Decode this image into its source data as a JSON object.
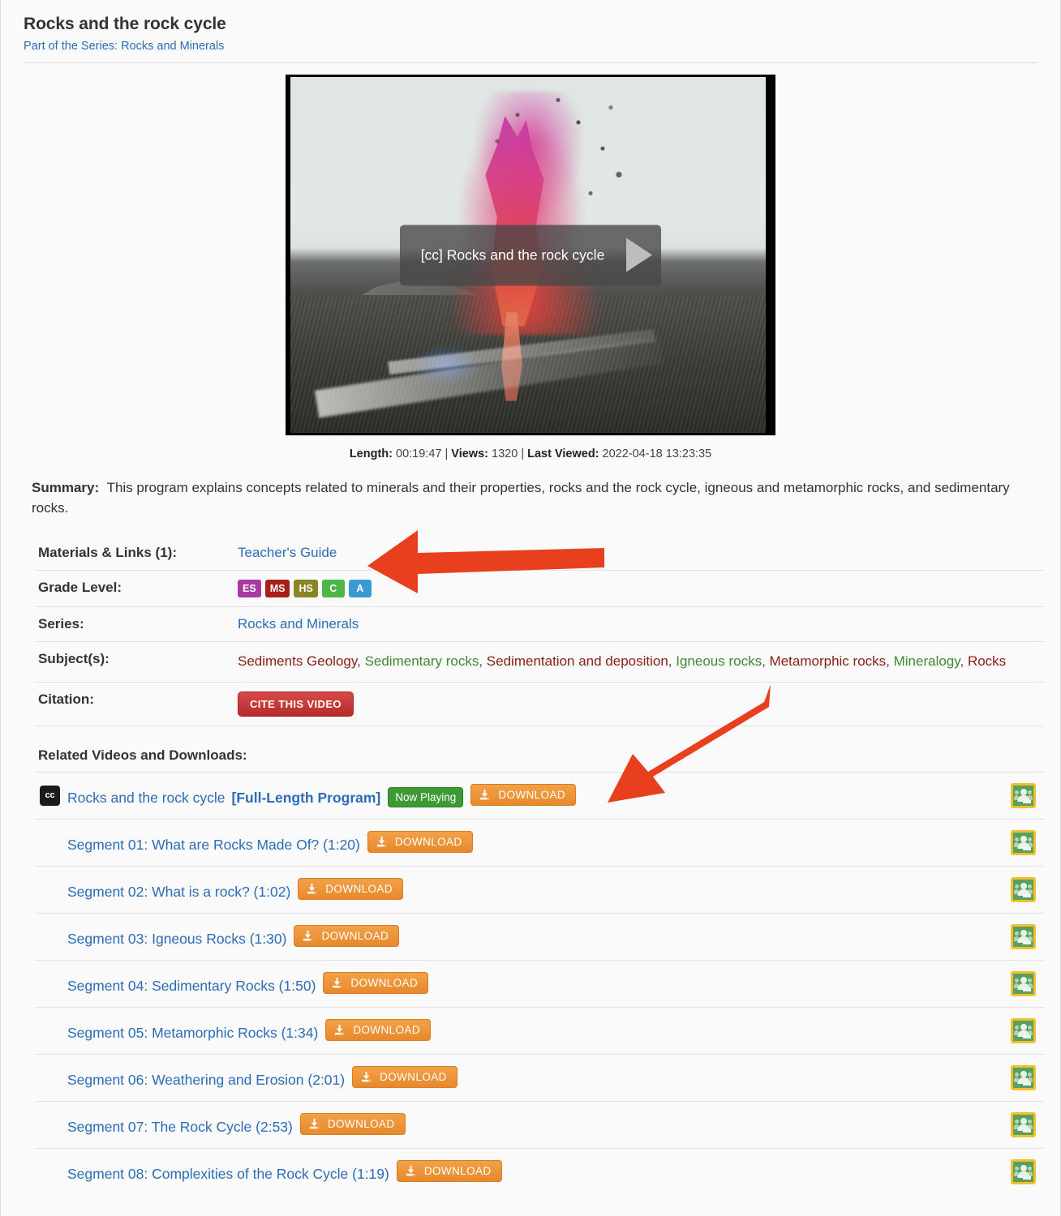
{
  "header": {
    "title": "Rocks and the rock cycle",
    "series_prefix": "Part of the Series:",
    "series_name": "Rocks and Minerals"
  },
  "player": {
    "overlay_title": "[cc] Rocks and the rock cycle",
    "play_icon": "play-triangle-icon"
  },
  "stats": {
    "length_label": "Length:",
    "length_value": "00:19:47",
    "sep1": "|",
    "views_label": "Views:",
    "views_value": "1320",
    "sep2": "|",
    "last_viewed_label": "Last Viewed:",
    "last_viewed_value": "2022-04-18 13:23:35"
  },
  "summary": {
    "label": "Summary:",
    "text": "This program explains concepts related to minerals and their properties, rocks and the rock cycle, igneous and metamorphic rocks, and sedimentary rocks."
  },
  "info": {
    "materials_label": "Materials & Links (1):",
    "materials_link": "Teacher's Guide",
    "grade_label": "Grade Level:",
    "grade_badges": [
      {
        "text": "ES",
        "color": "#a93aa5"
      },
      {
        "text": "MS",
        "color": "#a51f1b"
      },
      {
        "text": "HS",
        "color": "#8a8522"
      },
      {
        "text": "C",
        "color": "#4cb648"
      },
      {
        "text": "A",
        "color": "#3a9bd4"
      }
    ],
    "series_label": "Series:",
    "series_link": "Rocks and Minerals",
    "subjects_label": "Subject(s):",
    "subjects": [
      {
        "text": "Sediments Geology",
        "color": "#8b2017"
      },
      {
        "text": "Sedimentary rocks",
        "color": "#3f8a33"
      },
      {
        "text": "Sedimentation and deposition",
        "color": "#8b2017"
      },
      {
        "text": "Igneous rocks",
        "color": "#3f8a33"
      },
      {
        "text": "Metamorphic rocks",
        "color": "#8b2017"
      },
      {
        "text": "Mineralogy",
        "color": "#3f8a33"
      },
      {
        "text": "Rocks",
        "color": "#8b2017"
      }
    ],
    "citation_label": "Citation:",
    "citation_button": "CITE THIS VIDEO"
  },
  "related": {
    "heading": "Related Videos and Downloads:",
    "download_label": "DOWNLOAD",
    "now_playing_label": "Now Playing",
    "cc_label": "cc",
    "classroom_icon": "google-classroom-icon",
    "rows": [
      {
        "cc": true,
        "title": "Rocks and the rock cycle",
        "tag": "[Full-Length Program]",
        "now_playing": true,
        "indent": false
      },
      {
        "cc": false,
        "title": "Segment 01: What are Rocks Made Of? (1:20)",
        "tag": "",
        "now_playing": false,
        "indent": true
      },
      {
        "cc": false,
        "title": "Segment 02: What is a rock? (1:02)",
        "tag": "",
        "now_playing": false,
        "indent": true
      },
      {
        "cc": false,
        "title": "Segment 03: Igneous Rocks (1:30)",
        "tag": "",
        "now_playing": false,
        "indent": true
      },
      {
        "cc": false,
        "title": "Segment 04: Sedimentary Rocks (1:50)",
        "tag": "",
        "now_playing": false,
        "indent": true
      },
      {
        "cc": false,
        "title": "Segment 05: Metamorphic Rocks (1:34)",
        "tag": "",
        "now_playing": false,
        "indent": true
      },
      {
        "cc": false,
        "title": "Segment 06: Weathering and Erosion (2:01)",
        "tag": "",
        "now_playing": false,
        "indent": true
      },
      {
        "cc": false,
        "title": "Segment 07: The Rock Cycle (2:53)",
        "tag": "",
        "now_playing": false,
        "indent": true
      },
      {
        "cc": false,
        "title": "Segment 08: Complexities of the Rock Cycle (1:19)",
        "tag": "",
        "now_playing": false,
        "indent": true
      }
    ]
  },
  "annotations": {
    "arrow_color": "#e8401f",
    "arrows": [
      {
        "name": "arrow-pointing-to-teachers-guide"
      },
      {
        "name": "arrow-pointing-to-full-length-download"
      }
    ]
  }
}
